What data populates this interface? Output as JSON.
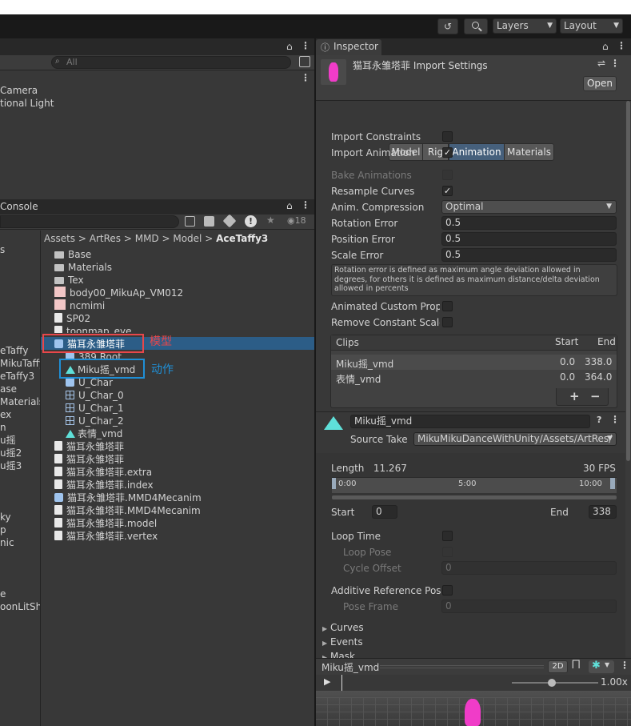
{
  "toolbar": {
    "layers": "Layers",
    "layout": "Layout",
    "history_icon": "history-icon",
    "search_icon": "search-icon"
  },
  "hierarchy": {
    "search_placeholder": "All",
    "items": [
      "Camera",
      "tional Light"
    ]
  },
  "console": {
    "title": "Console",
    "count": "18"
  },
  "project": {
    "breadcrumb": [
      "Assets",
      "ArtRes",
      "MMD",
      "Model",
      "AceTaffy3"
    ],
    "left_items": [
      "s",
      "eTaffy",
      "MikuГaffy2",
      "eTaffy3",
      "ase",
      "Materials",
      "ex",
      "n",
      "u摇",
      "u摇2",
      "u摇3",
      "ky",
      "p",
      "nic",
      "e",
      "oonLitSh"
    ],
    "left_items_clean": [
      "s",
      "eTaffy",
      "MikuГaffy2",
      "eTaffy3",
      "ase",
      "Materials",
      "ex",
      "n",
      "u摇",
      "u摇2",
      "u摇3",
      "ky",
      "p",
      "nic",
      "e",
      "oonLitSh"
    ],
    "tree": [
      {
        "label": "Base",
        "icon": "folder"
      },
      {
        "label": "Materials",
        "icon": "folder"
      },
      {
        "label": "Tex",
        "icon": "folder"
      },
      {
        "label": "body00_MikuAp_VM012",
        "icon": "img"
      },
      {
        "label": "ncmimi",
        "icon": "img"
      },
      {
        "label": "SP02",
        "icon": "doc"
      },
      {
        "label": "toonmap_eye",
        "icon": "doc"
      },
      {
        "label": "猫耳永雏塔菲",
        "icon": "cube"
      },
      {
        "label": "389 Root",
        "icon": "cube"
      },
      {
        "label": "Miku摇_vmd",
        "icon": "anim"
      },
      {
        "label": "U_Char",
        "icon": "cube"
      },
      {
        "label": "U_Char_0",
        "icon": "grid"
      },
      {
        "label": "U_Char_1",
        "icon": "grid"
      },
      {
        "label": "U_Char_2",
        "icon": "grid"
      },
      {
        "label": "表情_vmd",
        "icon": "anim"
      },
      {
        "label": "猫耳永雏塔菲",
        "icon": "doc"
      },
      {
        "label": "猫耳永雏塔菲",
        "icon": "doc"
      },
      {
        "label": "猫耳永雏塔菲.extra",
        "icon": "doc"
      },
      {
        "label": "猫耳永雏塔菲.index",
        "icon": "doc"
      },
      {
        "label": "猫耳永雏塔菲.MMD4Mecanim",
        "icon": "cube"
      },
      {
        "label": "猫耳永雏塔菲.MMD4Mecanim",
        "icon": "doc"
      },
      {
        "label": "猫耳永雏塔菲.model",
        "icon": "doc"
      },
      {
        "label": "猫耳永雏塔菲.vertex",
        "icon": "doc"
      }
    ],
    "annotation_model": "模型",
    "annotation_action": "动作"
  },
  "inspector": {
    "tab_title": "Inspector",
    "asset_title": "猫耳永雏塔菲 Import Settings",
    "open": "Open",
    "tabs": [
      "Model",
      "Rig",
      "Animation",
      "Materials"
    ],
    "import_constraints": "Import Constraints",
    "import_animation": "Import Animation",
    "bake_animations": "Bake Animations",
    "resample_curves": "Resample Curves",
    "anim_compression": "Anim. Compression",
    "anim_compression_value": "Optimal",
    "rotation_error": "Rotation Error",
    "rotation_error_value": "0.5",
    "position_error": "Position Error",
    "position_error_value": "0.5",
    "scale_error": "Scale Error",
    "scale_error_value": "0.5",
    "help": "Rotation error is defined as maximum angle deviation allowed in degrees, for others it is defined as maximum distance/delta deviation allowed in percents",
    "animated_custom": "Animated Custom Prope",
    "remove_constant": "Remove Constant Scale",
    "clips_header": "Clips",
    "start_header": "Start",
    "end_header": "End",
    "clips": [
      {
        "name": "Miku摇_vmd",
        "start": "0.0",
        "end": "338.0"
      },
      {
        "name": "表情_vmd",
        "start": "0.0",
        "end": "364.0"
      }
    ],
    "plus": "+",
    "minus": "−",
    "clip_name": "Miku摇_vmd",
    "source_take": "Source Take",
    "source_take_value": "MikuMikuDanceWithUnity/Assets/ArtRes/",
    "length": "Length",
    "length_value": "11.267",
    "fps": "30 FPS",
    "tl0": "0:00",
    "tl5": "5:00",
    "tl10": "10:00",
    "start": "Start",
    "start_value": "0",
    "end": "End",
    "end_value": "338",
    "loop_time": "Loop Time",
    "loop_pose": "Loop Pose",
    "cycle_offset": "Cycle Offset",
    "cycle_offset_value": "0",
    "additive": "Additive Reference Pose",
    "pose_frame": "Pose Frame",
    "pose_frame_value": "0",
    "curves": "Curves",
    "events": "Events",
    "mask": "Mask"
  },
  "preview": {
    "title": "Miku摇_vmd",
    "mode": "2D",
    "speed": "1.00x"
  }
}
